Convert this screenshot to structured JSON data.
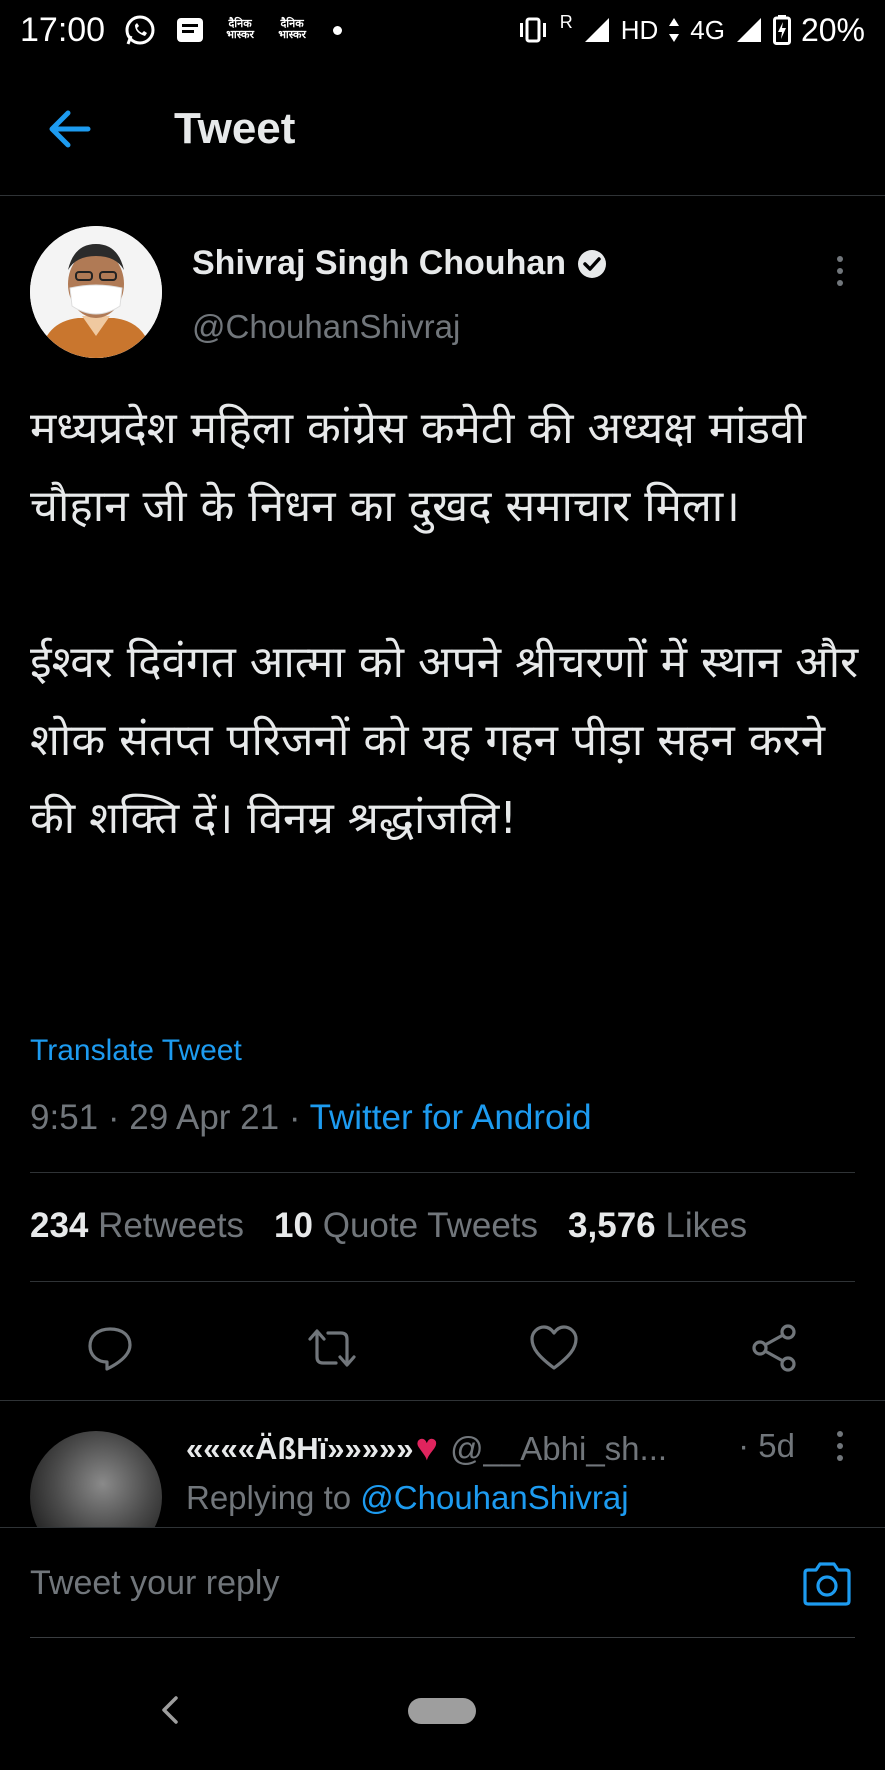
{
  "status_bar": {
    "time": "17:00",
    "news_label": "दैनिक भास्कर",
    "network": "HD",
    "network_type": "4G",
    "battery": "20%",
    "roaming": "R"
  },
  "header": {
    "title": "Tweet"
  },
  "tweet": {
    "author_name": "Shivraj Singh Chouhan",
    "author_handle": "@ChouhanShivraj",
    "text": "मध्यप्रदेश महिला कांग्रेस कमेटी की अध्यक्ष मांडवी चौहान जी के निधन का दुखद समाचार मिला।\n\nईश्वर दिवंगत आत्मा को अपने श्रीचरणों में स्थान और शोक संतप्त परिजनों को यह गहन पीड़ा सहन करने की शक्ति दें। विनम्र श्रद्धांजलि!",
    "translate_label": "Translate Tweet",
    "time": "9:51",
    "date": "29 Apr 21",
    "client": "Twitter for Android",
    "stats": {
      "retweets_count": "234",
      "retweets_label": "Retweets",
      "quotes_count": "10",
      "quotes_label": "Quote Tweets",
      "likes_count": "3,576",
      "likes_label": "Likes"
    }
  },
  "reply": {
    "name": "««««ÄßHï»»»»»",
    "heart": "♥",
    "handle": "@__Abhi_sh...",
    "time": "· 5d",
    "replying_prefix": "Replying to",
    "replying_to": "@ChouhanShivraj"
  },
  "compose": {
    "placeholder": "Tweet your reply"
  },
  "colors": {
    "accent": "#1d9bf0",
    "background": "#000000",
    "muted_text": "#71767b",
    "heart": "#e0245e"
  }
}
